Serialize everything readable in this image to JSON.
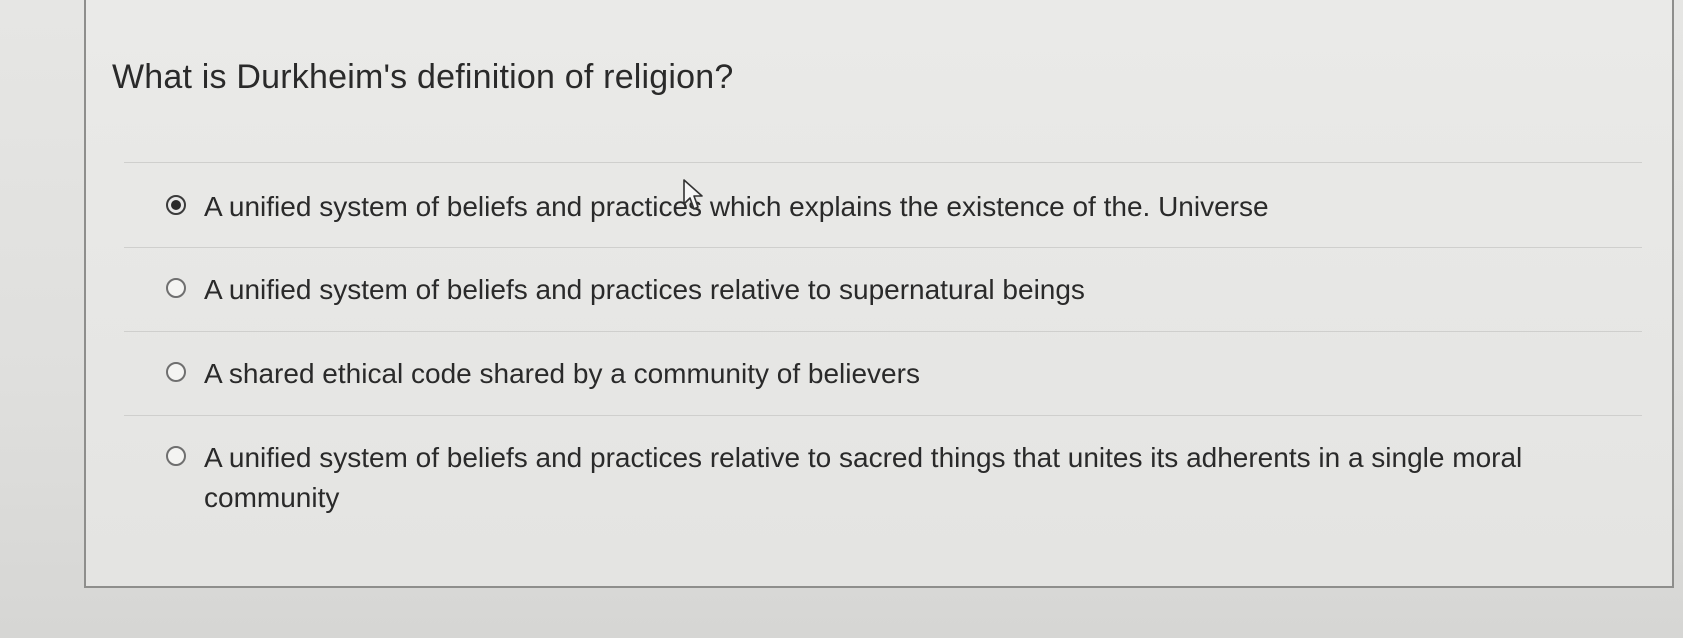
{
  "question": {
    "title": "What is Durkheim's definition of religion?"
  },
  "options": [
    {
      "label": "A unified system of beliefs and practices which explains the existence of the. Universe",
      "selected": true
    },
    {
      "label": "A unified system of beliefs and practices relative to supernatural beings",
      "selected": false
    },
    {
      "label": "A shared ethical code shared by a community of believers",
      "selected": false
    },
    {
      "label": "A unified system of beliefs and practices relative to sacred things that unites its adherents in a single moral community",
      "selected": false
    }
  ],
  "cursor": {
    "icon": "mouse-pointer-icon"
  }
}
